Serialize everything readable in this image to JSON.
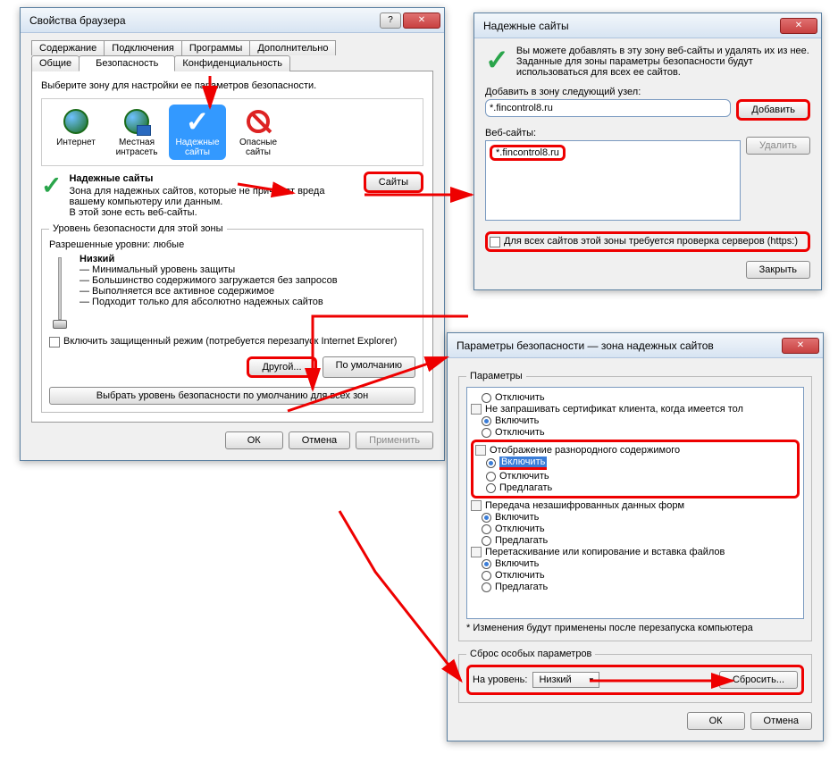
{
  "win1": {
    "title": "Свойства браузера",
    "tabs_row1": [
      "Содержание",
      "Подключения",
      "Программы",
      "Дополнительно"
    ],
    "tabs_row2": [
      "Общие",
      "Безопасность",
      "Конфиденциальность"
    ],
    "active_tab": "Безопасность",
    "zone_prompt": "Выберите зону для настройки ее параметров безопасности.",
    "zones": [
      {
        "label": "Интернет"
      },
      {
        "label": "Местная интрасеть"
      },
      {
        "label": "Надежные сайты"
      },
      {
        "label": "Опасные сайты"
      }
    ],
    "sites_btn": "Сайты",
    "sel_title": "Надежные сайты",
    "sel_desc1": "Зона для надежных сайтов, которые не причинят вреда вашему компьютеру или данным.",
    "sel_desc2": "В этой зоне есть веб-сайты.",
    "level_legend": "Уровень безопасности для этой зоны",
    "allowed": "Разрешенные уровни: любые",
    "level_name": "Низкий",
    "level_b1": "— Минимальный уровень защиты",
    "level_b2": "— Большинство содержимого загружается без запросов",
    "level_b3": "— Выполняется все активное содержимое",
    "level_b4": "— Подходит только для абсолютно надежных сайтов",
    "protected": "Включить защищенный режим (потребуется перезапуск Internet Explorer)",
    "btn_other": "Другой...",
    "btn_default": "По умолчанию",
    "btn_default_all": "Выбрать уровень безопасности по умолчанию для всех зон",
    "btn_ok": "ОК",
    "btn_cancel": "Отмена",
    "btn_apply": "Применить"
  },
  "win2": {
    "title": "Надежные сайты",
    "intro": "Вы можете добавлять в эту зону веб-сайты и удалять их из нее. Заданные для зоны параметры безопасности будут использоваться для всех ее сайтов.",
    "add_label": "Добавить в зону следующий узел:",
    "add_value": "*.fincontrol8.ru",
    "btn_add": "Добавить",
    "sites_label": "Веб-сайты:",
    "site_item": "*.fincontrol8.ru",
    "btn_del": "Удалить",
    "https_chk": "Для всех сайтов этой зоны требуется проверка серверов (https:)",
    "btn_close": "Закрыть"
  },
  "win3": {
    "title": "Параметры безопасности — зона надежных сайтов",
    "params_legend": "Параметры",
    "items": {
      "i1": "Отключить",
      "i2": "Не запрашивать сертификат клиента, когда имеется тол",
      "i3": "Включить",
      "i4": "Отключить",
      "i5": "Отображение разнородного содержимого",
      "i6": "Включить",
      "i7": "Отключить",
      "i8": "Предлагать",
      "i9": "Передача незашифрованных данных форм",
      "i10": "Включить",
      "i11": "Отключить",
      "i12": "Предлагать",
      "i13": "Перетаскивание или копирование и вставка файлов",
      "i14": "Включить",
      "i15": "Отключить",
      "i16": "Предлагать"
    },
    "footnote": "* Изменения будут применены после перезапуска компьютера",
    "reset_legend": "Сброс особых параметров",
    "reset_label": "На уровень:",
    "reset_value": "Низкий",
    "btn_reset": "Сбросить...",
    "btn_ok": "ОК",
    "btn_cancel": "Отмена"
  }
}
